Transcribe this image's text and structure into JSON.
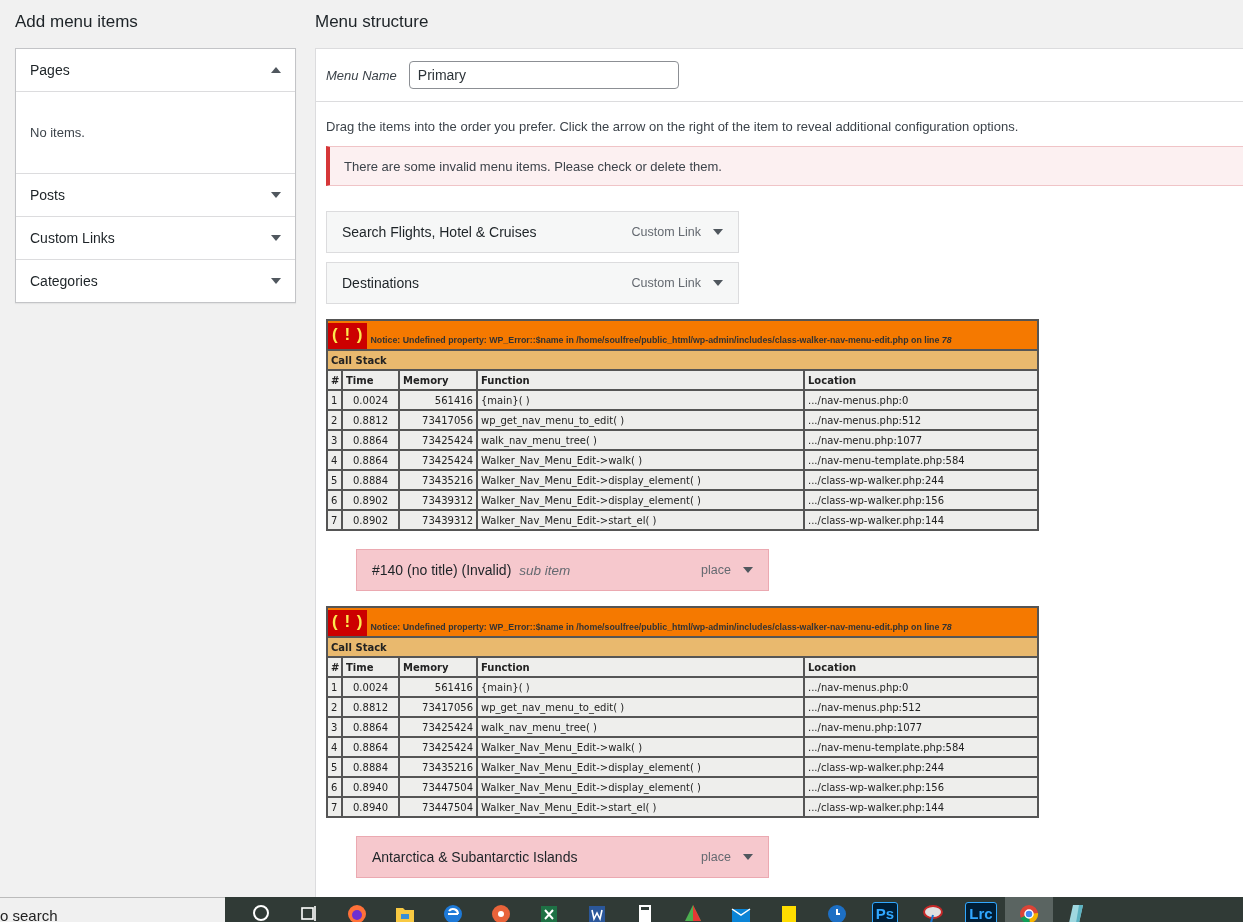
{
  "left_panel": {
    "title": "Add menu items",
    "sections": [
      {
        "label": "Pages",
        "expanded": true,
        "content": "No items."
      },
      {
        "label": "Posts",
        "expanded": false
      },
      {
        "label": "Custom Links",
        "expanded": false
      },
      {
        "label": "Categories",
        "expanded": false
      }
    ]
  },
  "menu_structure": {
    "title": "Menu structure",
    "menu_name_label": "Menu Name",
    "menu_name_value": "Primary",
    "instructions": "Drag the items into the order you prefer. Click the arrow on the right of the item to reveal additional configuration options.",
    "error_notice": "There are some invalid menu items. Please check or delete them.",
    "items": [
      {
        "kind": "item",
        "title": "Search Flights, Hotel & Cruises",
        "type_label": "Custom Link",
        "invalid": false
      },
      {
        "kind": "item",
        "title": "Destinations",
        "type_label": "Custom Link",
        "invalid": false
      },
      {
        "kind": "notice",
        "icon": "( ! )",
        "message": "Notice: Undefined property: WP_Error::$name in /home/soulfree/public_html/wp-admin/includes/class-walker-nav-menu-edit.php on line *78*",
        "stack_title": "Call Stack",
        "columns": [
          "#",
          "Time",
          "Memory",
          "Function",
          "Location"
        ],
        "rows": [
          [
            "1",
            "0.0024",
            "561416",
            "{main}( )",
            ".../nav-menus.php:0"
          ],
          [
            "2",
            "0.8812",
            "73417056",
            "wp_get_nav_menu_to_edit( )",
            ".../nav-menus.php:512"
          ],
          [
            "3",
            "0.8864",
            "73425424",
            "walk_nav_menu_tree( )",
            ".../nav-menu.php:1077"
          ],
          [
            "4",
            "0.8864",
            "73425424",
            "Walker_Nav_Menu_Edit->walk( )",
            ".../nav-menu-template.php:584"
          ],
          [
            "5",
            "0.8884",
            "73435216",
            "Walker_Nav_Menu_Edit->display_element( )",
            ".../class-wp-walker.php:244"
          ],
          [
            "6",
            "0.8902",
            "73439312",
            "Walker_Nav_Menu_Edit->display_element( )",
            ".../class-wp-walker.php:156"
          ],
          [
            "7",
            "0.8902",
            "73439312",
            "Walker_Nav_Menu_Edit->start_el( )",
            ".../class-wp-walker.php:144"
          ]
        ]
      },
      {
        "kind": "item",
        "title": "#140 (no title) (Invalid)",
        "sub_label": "sub item",
        "type_label": "place",
        "invalid": true
      },
      {
        "kind": "notice",
        "icon": "( ! )",
        "message": "Notice: Undefined property: WP_Error::$name in /home/soulfree/public_html/wp-admin/includes/class-walker-nav-menu-edit.php on line *78*",
        "stack_title": "Call Stack",
        "columns": [
          "#",
          "Time",
          "Memory",
          "Function",
          "Location"
        ],
        "rows": [
          [
            "1",
            "0.0024",
            "561416",
            "{main}( )",
            ".../nav-menus.php:0"
          ],
          [
            "2",
            "0.8812",
            "73417056",
            "wp_get_nav_menu_to_edit( )",
            ".../nav-menus.php:512"
          ],
          [
            "3",
            "0.8864",
            "73425424",
            "walk_nav_menu_tree( )",
            ".../nav-menu.php:1077"
          ],
          [
            "4",
            "0.8864",
            "73425424",
            "Walker_Nav_Menu_Edit->walk( )",
            ".../nav-menu-template.php:584"
          ],
          [
            "5",
            "0.8884",
            "73435216",
            "Walker_Nav_Menu_Edit->display_element( )",
            ".../class-wp-walker.php:244"
          ],
          [
            "6",
            "0.8940",
            "73447504",
            "Walker_Nav_Menu_Edit->display_element( )",
            ".../class-wp-walker.php:156"
          ],
          [
            "7",
            "0.8940",
            "73447504",
            "Walker_Nav_Menu_Edit->start_el( )",
            ".../class-wp-walker.php:144"
          ]
        ]
      },
      {
        "kind": "item",
        "title": "Antarctica & Subantarctic Islands",
        "type_label": "place",
        "invalid": true
      }
    ]
  },
  "taskbar": {
    "search_text": "o search",
    "apps": [
      {
        "kind": "search",
        "selected": false
      },
      {
        "kind": "taskview",
        "selected": false
      },
      {
        "kind": "firefox",
        "selected": false
      },
      {
        "kind": "folder",
        "selected": false
      },
      {
        "kind": "edge",
        "selected": false
      },
      {
        "kind": "disc",
        "selected": false
      },
      {
        "kind": "sheet",
        "selected": false
      },
      {
        "kind": "doc",
        "selected": false
      },
      {
        "kind": "calc",
        "selected": false
      },
      {
        "kind": "prism",
        "selected": false
      },
      {
        "kind": "mail",
        "selected": false
      },
      {
        "kind": "note",
        "selected": false
      },
      {
        "kind": "clock",
        "selected": false
      },
      {
        "kind": "badge",
        "label": "Ps",
        "selected": false
      },
      {
        "kind": "dish",
        "selected": false
      },
      {
        "kind": "badge",
        "label": "Lrc",
        "selected": false
      },
      {
        "kind": "chrome",
        "selected": true
      },
      {
        "kind": "crystal",
        "selected": false
      }
    ]
  }
}
